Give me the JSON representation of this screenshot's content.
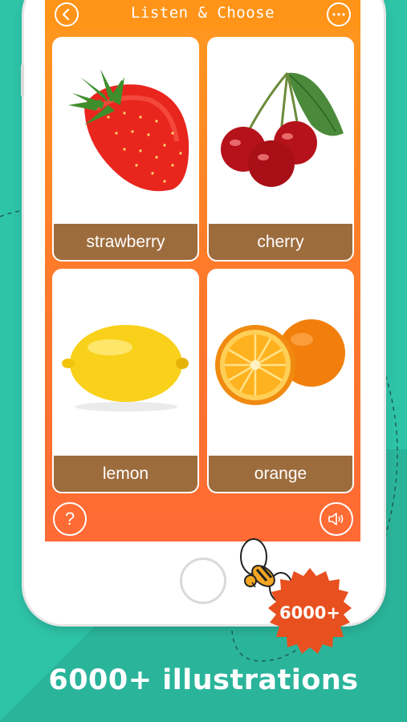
{
  "header": {
    "title": "Listen & Choose",
    "back_icon": "chevron-left-icon",
    "more_icon": "more-dots-icon"
  },
  "cards": [
    {
      "label": "strawberry",
      "image": "strawberry"
    },
    {
      "label": "cherry",
      "image": "cherry"
    },
    {
      "label": "lemon",
      "image": "lemon"
    },
    {
      "label": "orange",
      "image": "orange"
    }
  ],
  "footer": {
    "help_label": "?",
    "help_icon": "question-icon",
    "sound_icon": "speaker-icon"
  },
  "badge": {
    "text": "6000+"
  },
  "caption": "6000+ illustrations",
  "colors": {
    "background": "#2ec4a8",
    "screen_orange": "#ff8a26",
    "label_brown": "#9d6c3d",
    "badge_red": "#e8501f"
  }
}
